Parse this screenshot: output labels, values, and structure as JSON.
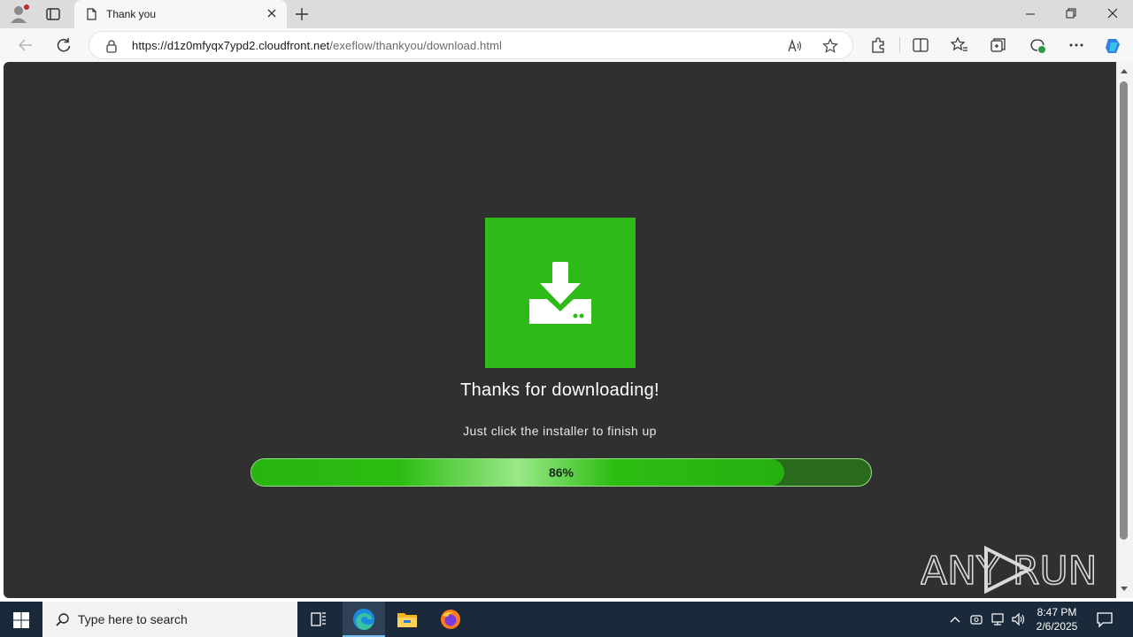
{
  "browser": {
    "tab_title": "Thank you",
    "url_host": "https://d1z0mfyqx7ypd2.cloudfront.net",
    "url_path": "/exeflow/thankyou/download.html"
  },
  "page": {
    "heading": "Thanks for downloading!",
    "subtext": "Just click the installer to finish up",
    "progress_percent": 86,
    "progress_label": "86%",
    "accent_color": "#2ebb17",
    "background_color": "#303030"
  },
  "watermark": {
    "text": "ANY RUN"
  },
  "taskbar": {
    "search_placeholder": "Type here to search",
    "time": "8:47 PM",
    "date": "2/6/2025",
    "pinned": [
      "task-view-icon",
      "edge-icon",
      "file-explorer-icon",
      "firefox-icon"
    ]
  }
}
